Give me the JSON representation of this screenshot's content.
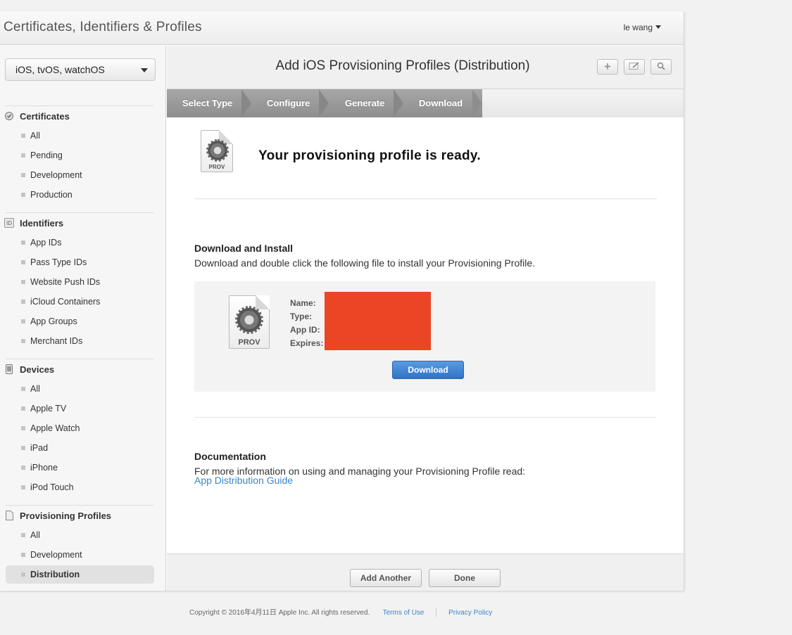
{
  "header": {
    "title": "Certificates, Identifiers & Profiles",
    "user": "le wang"
  },
  "sidebar": {
    "platform": "iOS, tvOS, watchOS",
    "sections": [
      {
        "title": "Certificates",
        "icon": "certificate-icon",
        "items": [
          "All",
          "Pending",
          "Development",
          "Production"
        ]
      },
      {
        "title": "Identifiers",
        "icon": "id-icon",
        "icon_text": "ID",
        "items": [
          "App IDs",
          "Pass Type IDs",
          "Website Push IDs",
          "iCloud Containers",
          "App Groups",
          "Merchant IDs"
        ]
      },
      {
        "title": "Devices",
        "icon": "device-icon",
        "items": [
          "All",
          "Apple TV",
          "Apple Watch",
          "iPad",
          "iPhone",
          "iPod Touch"
        ]
      },
      {
        "title": "Provisioning Profiles",
        "icon": "document-icon",
        "items": [
          "All",
          "Development",
          "Distribution"
        ]
      }
    ],
    "active_item": "Distribution"
  },
  "main": {
    "title": "Add iOS Provisioning Profiles (Distribution)",
    "toolbar": {
      "add": "plus-icon",
      "edit": "edit-icon",
      "search": "search-icon"
    },
    "steps": [
      "Select Type",
      "Configure",
      "Generate",
      "Download"
    ],
    "ready_message": "Your provisioning profile is ready.",
    "icon_label": "PROV",
    "download_section": {
      "heading": "Download and Install",
      "text": "Download and double click the following file to install your Provisioning Profile.",
      "fields": [
        "Name:",
        "Type:",
        "App ID:",
        "Expires:"
      ],
      "button": "Download"
    },
    "documentation": {
      "heading": "Documentation",
      "text": "For more information on using and managing your Provisioning Profile read:",
      "link": "App Distribution Guide"
    },
    "footer_buttons": {
      "add_another": "Add Another",
      "done": "Done"
    }
  },
  "page_footer": {
    "copyright": "Copyright © 2016年4月11日 Apple Inc. All rights reserved.",
    "terms": "Terms of Use",
    "privacy": "Privacy Policy"
  },
  "colors": {
    "accent": "#3a87c8",
    "redaction": "#ea4524",
    "button_blue": "#2f73c9"
  }
}
